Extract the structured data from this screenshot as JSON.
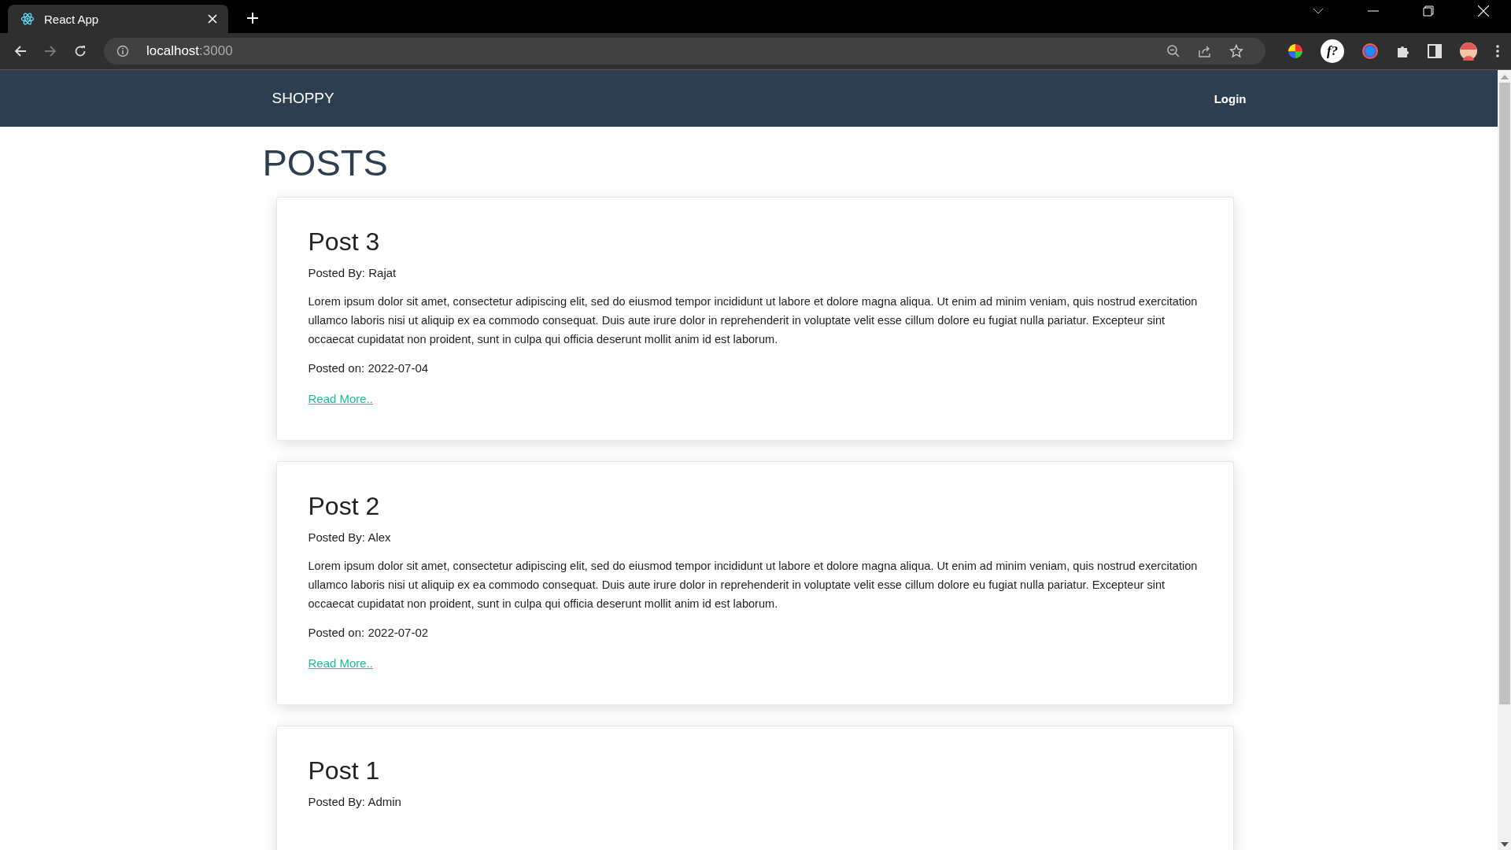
{
  "browser": {
    "tab_title": "React App",
    "url_host": "localhost",
    "url_port": ":3000",
    "extension_badge": "f?"
  },
  "navbar": {
    "brand": "SHOPPY",
    "links": [
      "Login"
    ]
  },
  "heading": "POSTS",
  "posts": [
    {
      "title": "Post 3",
      "author": "Posted By: Rajat",
      "body": "Lorem ipsum dolor sit amet, consectetur adipiscing elit, sed do eiusmod tempor incididunt ut labore et dolore magna aliqua. Ut enim ad minim veniam, quis nostrud exercitation ullamco laboris nisi ut aliquip ex ea commodo consequat. Duis aute irure dolor in reprehenderit in voluptate velit esse cillum dolore eu fugiat nulla pariatur. Excepteur sint occaecat cupidatat non proident, sunt in culpa qui officia deserunt mollit anim id est laborum.",
      "date": "Posted on: 2022-07-04",
      "link": "Read More.."
    },
    {
      "title": "Post 2",
      "author": "Posted By: Alex",
      "body": "Lorem ipsum dolor sit amet, consectetur adipiscing elit, sed do eiusmod tempor incididunt ut labore et dolore magna aliqua. Ut enim ad minim veniam, quis nostrud exercitation ullamco laboris nisi ut aliquip ex ea commodo consequat. Duis aute irure dolor in reprehenderit in voluptate velit esse cillum dolore eu fugiat nulla pariatur. Excepteur sint occaecat cupidatat non proident, sunt in culpa qui officia deserunt mollit anim id est laborum.",
      "date": "Posted on: 2022-07-02",
      "link": "Read More.."
    },
    {
      "title": "Post 1",
      "author": "Posted By: Admin"
    }
  ]
}
